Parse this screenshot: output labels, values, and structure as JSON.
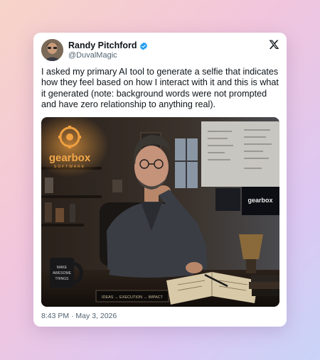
{
  "tweet": {
    "author": {
      "display_name": "Randy Pitchford",
      "handle": "@DuvalMagic",
      "verified": true
    },
    "text": "I asked my primary AI tool to generate a selfie that indicates how they feel based on how I interact with it and this is what it generated (note: background words were not prompted and have zero relationship to anything real).",
    "timestamp": "8:43 PM · May 3, 2026",
    "media": {
      "sign_brand": "gearbox",
      "sign_sub": "SOFTWARE",
      "monitor_brand": "gearbox",
      "mug_text_1": "MAKE",
      "mug_text_2": "AWESOME",
      "mug_text_3": "THINGS",
      "desk_plaque": "IDEAS → EXECUTION → IMPACT"
    }
  },
  "colors": {
    "verified_blue": "#1d9bf0",
    "text_primary": "#0f1419",
    "text_secondary": "#536471"
  },
  "icons": {
    "verified": "verified-badge-icon",
    "platform": "x-logo-icon"
  }
}
